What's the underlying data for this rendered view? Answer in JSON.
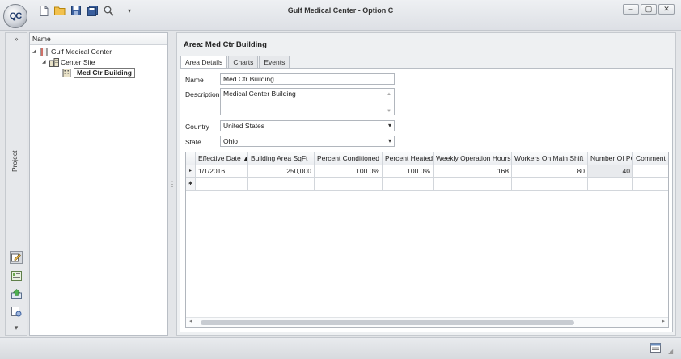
{
  "window": {
    "title": "Gulf Medical Center - Option C",
    "logo_text": "QC"
  },
  "sidebar": {
    "expand_glyph": "»",
    "vertical_label": "Project",
    "collapse_glyph": "▾"
  },
  "tree": {
    "header": "Name",
    "items": [
      {
        "label": "Gulf Medical Center",
        "icon": "book-icon"
      },
      {
        "label": "Center Site",
        "icon": "buildings-icon"
      },
      {
        "label": "Med Ctr Building",
        "icon": "building-icon"
      }
    ]
  },
  "detail": {
    "title": "Area: Med Ctr Building",
    "tabs": [
      "Area Details",
      "Charts",
      "Events"
    ],
    "fields": {
      "name_label": "Name",
      "name_value": "Med Ctr Building",
      "description_label": "Description",
      "description_value": "Medical Center Building",
      "country_label": "Country",
      "country_value": "United States",
      "state_label": "State",
      "state_value": "Ohio"
    },
    "grid": {
      "columns": [
        "Effective Date ▲",
        "Building Area SqFt",
        "Percent Conditioned",
        "Percent Heated",
        "Weekly Operation Hours",
        "Workers On Main Shift",
        "Number Of PC",
        "Comment"
      ],
      "rows": [
        [
          "1/1/2016",
          "250,000",
          "100.0%",
          "100.0%",
          "168",
          "80",
          "40",
          ""
        ]
      ],
      "row_indicator": "▸",
      "new_row_indicator": "✱",
      "scroll_left": "◂",
      "scroll_right": "▸"
    }
  },
  "colors": {
    "accent": "#1f3a6b",
    "selection_border": "#777777"
  }
}
